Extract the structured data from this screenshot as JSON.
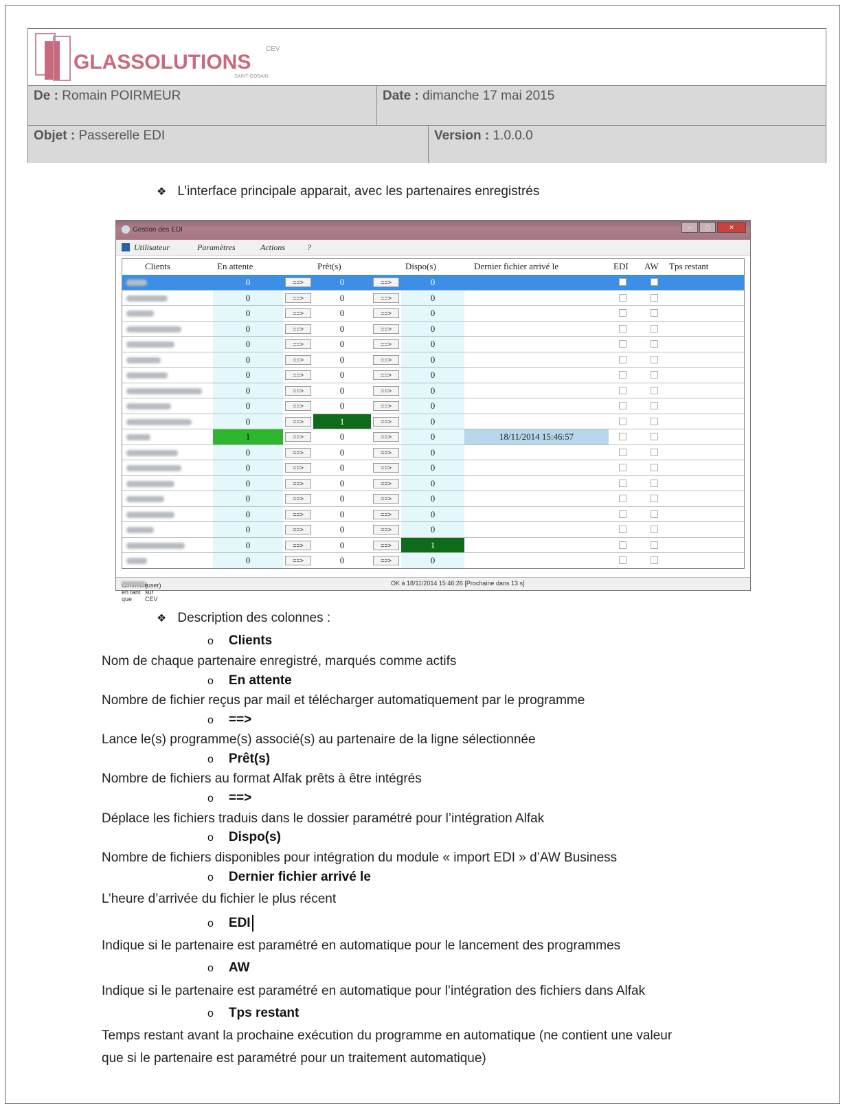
{
  "header": {
    "logo_text": "GLASSOLUTIONS",
    "logo_suffix": "CEV",
    "logo_tagline": "SAINT-GOBAIN",
    "from_label": "De :",
    "from_value": "Romain POIRMEUR",
    "date_label": "Date :",
    "date_value": "dimanche 17 mai 2015",
    "subject_label": "Objet :",
    "subject_value": "Passerelle EDI",
    "version_label": "Version :",
    "version_value": "1.0.0.0"
  },
  "intro_bullet": "L’interface principale apparait, avec les partenaires enregistrés",
  "app": {
    "title": "Gestion des EDI",
    "menu": [
      "Utilisateur",
      "Paramètres",
      "Actions",
      "?"
    ],
    "columns": [
      "Clients",
      "En attente",
      "Prêt(s)",
      "Dispo(s)",
      "Dernier fichier arrivé le",
      "EDI",
      "AW",
      "Tps restant"
    ],
    "button_label": "==>",
    "rows": [
      {
        "att": "0",
        "pret": "0",
        "dispo": "0",
        "date": ""
      },
      {
        "att": "0",
        "pret": "0",
        "dispo": "0",
        "date": ""
      },
      {
        "att": "0",
        "pret": "0",
        "dispo": "0",
        "date": ""
      },
      {
        "att": "0",
        "pret": "0",
        "dispo": "0",
        "date": ""
      },
      {
        "att": "0",
        "pret": "0",
        "dispo": "0",
        "date": ""
      },
      {
        "att": "0",
        "pret": "0",
        "dispo": "0",
        "date": ""
      },
      {
        "att": "0",
        "pret": "0",
        "dispo": "0",
        "date": ""
      },
      {
        "att": "0",
        "pret": "0",
        "dispo": "0",
        "date": ""
      },
      {
        "att": "0",
        "pret": "0",
        "dispo": "0",
        "date": ""
      },
      {
        "att": "0",
        "pret": "1",
        "dispo": "0",
        "date": ""
      },
      {
        "att": "1",
        "pret": "0",
        "dispo": "0",
        "date": "18/11/2014 15:46:57"
      },
      {
        "att": "0",
        "pret": "0",
        "dispo": "0",
        "date": ""
      },
      {
        "att": "0",
        "pret": "0",
        "dispo": "0",
        "date": ""
      },
      {
        "att": "0",
        "pret": "0",
        "dispo": "0",
        "date": ""
      },
      {
        "att": "0",
        "pret": "0",
        "dispo": "0",
        "date": ""
      },
      {
        "att": "0",
        "pret": "0",
        "dispo": "0",
        "date": ""
      },
      {
        "att": "0",
        "pret": "0",
        "dispo": "0",
        "date": ""
      },
      {
        "att": "0",
        "pret": "0",
        "dispo": "1",
        "date": ""
      },
      {
        "att": "0",
        "pret": "0",
        "dispo": "0",
        "date": ""
      }
    ],
    "status_left_prefix": "Connecté en tant que",
    "status_left_suffix": "(user) sur CEV",
    "status_right": "OK à 18/11/2014 15:46:26 [Prochaine dans 13 s]",
    "colors": {
      "selected": "#3d8fe6",
      "pending": "#2db52d",
      "ready": "#0e6b1a",
      "date_hl": "#b7d7ea"
    }
  },
  "desc_bullet": "Description des colonnes :",
  "descriptions": [
    {
      "title": "Clients",
      "text": "Nom de chaque partenaire enregistré, marqués comme actifs"
    },
    {
      "title": "En attente",
      "text": "Nombre de fichier reçus par mail et télécharger automatiquement par le programme"
    },
    {
      "title": "==>",
      "text": "Lance le(s) programme(s) associé(s) au partenaire de la ligne sélectionnée"
    },
    {
      "title": "Prêt(s)",
      "text": "Nombre de fichiers au format Alfak prêts à être intégrés"
    },
    {
      "title": "==>",
      "text": "Déplace les fichiers traduis dans le dossier paramétré pour l’intégration Alfak"
    },
    {
      "title": "Dispo(s)",
      "text": "Nombre de fichiers disponibles pour intégration du module « import EDI » d’AW Business"
    },
    {
      "title": "Dernier fichier arrivé le",
      "text": "L’heure d’arrivée du fichier le plus récent"
    },
    {
      "title": "EDI",
      "text": "Indique si le partenaire est paramétré en automatique pour le lancement des programmes"
    },
    {
      "title": "AW",
      "text": "Indique si le partenaire est paramétré en automatique pour l’intégration des fichiers dans Alfak"
    },
    {
      "title": "Tps restant",
      "text": "Temps restant avant la prochaine exécution du programme en automatique (ne contient une valeur"
    },
    {
      "title": "",
      "text": "que si le partenaire est paramétré pour un traitement automatique)"
    }
  ]
}
